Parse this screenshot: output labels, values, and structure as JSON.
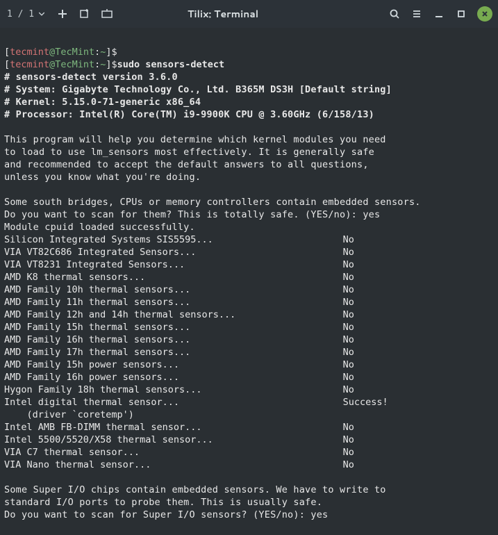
{
  "titlebar": {
    "session": "1 / 1",
    "title": "Tilix: Terminal"
  },
  "prompt": {
    "user": "tecmint",
    "host": "TecMint",
    "path": "~"
  },
  "cmd": {
    "sensors_detect": "sudo sensors-detect"
  },
  "out": {
    "l1": "# sensors-detect version 3.6.0",
    "l2": "# System: Gigabyte Technology Co., Ltd. B365M DS3H [Default string]",
    "l3": "# Kernel: 5.15.0-71-generic x86_64",
    "l4": "# Processor: Intel(R) Core(TM) i9-9900K CPU @ 3.60GHz (6/158/13)",
    "p1a": "This program will help you determine which kernel modules you need",
    "p1b": "to load to use lm_sensors most effectively. It is generally safe",
    "p1c": "and recommended to accept the default answers to all questions,",
    "p1d": "unless you know what you're doing.",
    "p2a": "Some south bridges, CPUs or memory controllers contain embedded sensors.",
    "p2b": "Do you want to scan for them? This is totally safe. (YES/no): yes",
    "p2c": "Module cpuid loaded successfully.",
    "s1": "Silicon Integrated Systems SIS5595...                       No",
    "s2": "VIA VT82C686 Integrated Sensors...                          No",
    "s3": "VIA VT8231 Integrated Sensors...                            No",
    "s4": "AMD K8 thermal sensors...                                   No",
    "s5": "AMD Family 10h thermal sensors...                           No",
    "s6": "AMD Family 11h thermal sensors...                           No",
    "s7": "AMD Family 12h and 14h thermal sensors...                   No",
    "s8": "AMD Family 15h thermal sensors...                           No",
    "s9": "AMD Family 16h thermal sensors...                           No",
    "s10": "AMD Family 17h thermal sensors...                           No",
    "s11": "AMD Family 15h power sensors...                             No",
    "s12": "AMD Family 16h power sensors...                             No",
    "s13": "Hygon Family 18h thermal sensors...                         No",
    "s14": "Intel digital thermal sensor...                             Success!",
    "s14b": "    (driver `coretemp')",
    "s15": "Intel AMB FB-DIMM thermal sensor...                         No",
    "s16": "Intel 5500/5520/X58 thermal sensor...                       No",
    "s17": "VIA C7 thermal sensor...                                    No",
    "s18": "VIA Nano thermal sensor...                                  No",
    "p3a": "Some Super I/O chips contain embedded sensors. We have to write to",
    "p3b": "standard I/O ports to probe them. This is usually safe.",
    "p3c": "Do you want to scan for Super I/O sensors? (YES/no): yes"
  }
}
